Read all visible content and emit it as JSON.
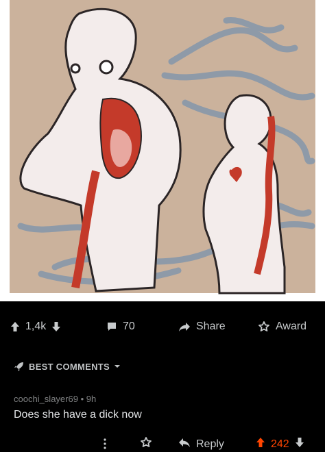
{
  "post": {
    "image_alt": "Illustration of two figures connected by flowing ribbons, one figure holding a red cutout from its chest",
    "score": "1,4k",
    "comments_count": "70",
    "share_label": "Share",
    "award_label": "Award"
  },
  "comments_section": {
    "sort_label": "BEST COMMENTS"
  },
  "comment": {
    "author": "coochi_slayer69",
    "separator": "•",
    "age": "9h",
    "body": "Does she have a dick now",
    "reply_label": "Reply",
    "score": "242"
  },
  "colors": {
    "background": "#000000",
    "upvote_active": "#ff4500",
    "text_primary": "#d7dadc",
    "text_meta": "#818384"
  },
  "icons": [
    "upvote-icon",
    "downvote-icon",
    "comment-icon",
    "share-icon",
    "award-icon",
    "rocket-icon",
    "chevron-down-icon",
    "more-icon",
    "reply-icon"
  ]
}
